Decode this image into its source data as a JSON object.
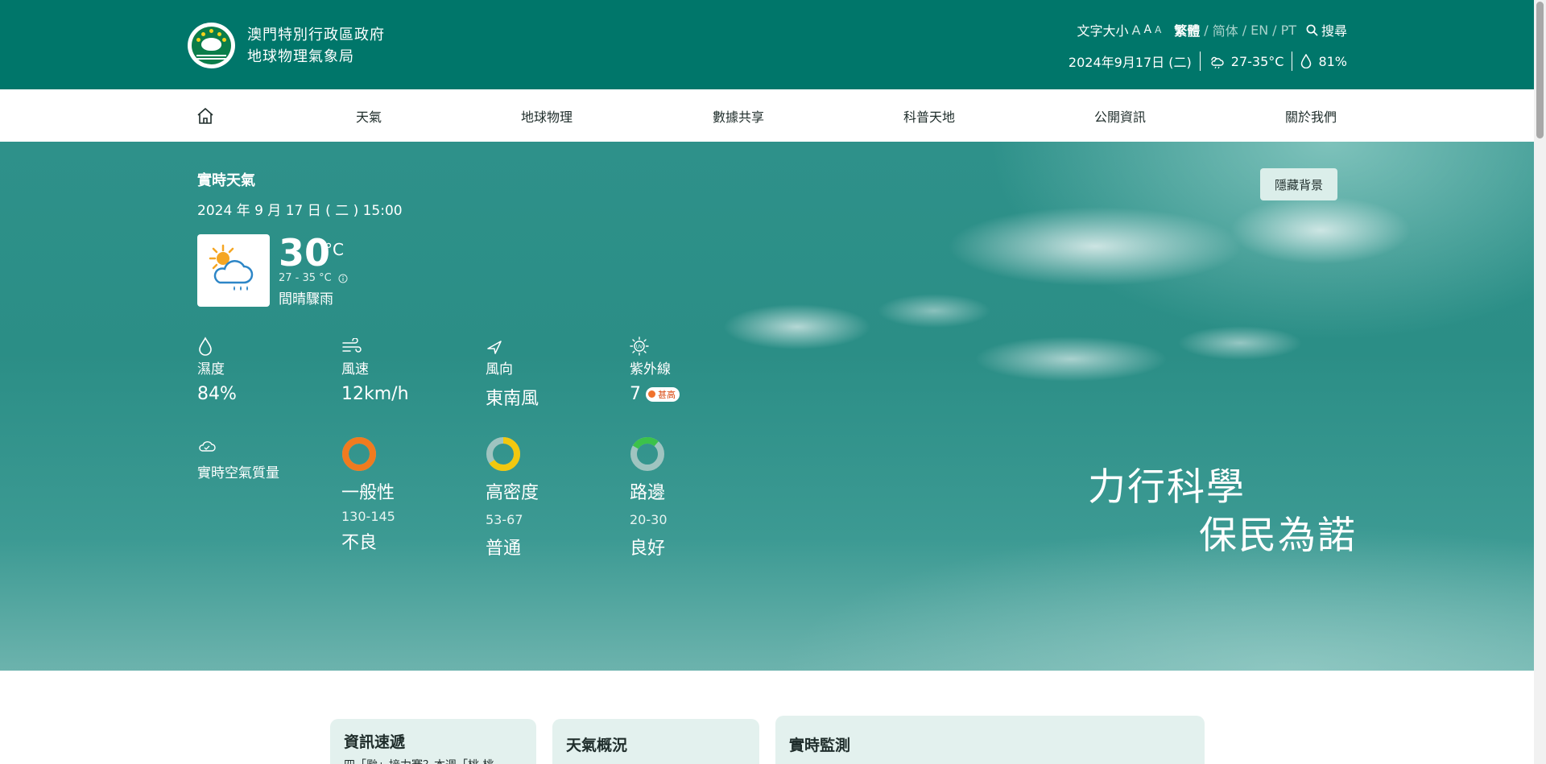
{
  "header": {
    "org_line1": "澳門特別行政區政府",
    "org_line2": "地球物理氣象局",
    "font_size_label": "文字大小",
    "font_a": "A",
    "languages": {
      "trad": "繁體",
      "simp": "简体",
      "en": "EN",
      "pt": "PT",
      "sep": "/"
    },
    "search_label": "搜尋",
    "date": "2024年9月17日 (二)",
    "temp_range": "27-35°C",
    "humidity": "81%"
  },
  "nav": {
    "items": [
      "天氣",
      "地球物理",
      "數據共享",
      "科普天地",
      "公開資訊",
      "關於我們"
    ]
  },
  "hero": {
    "title": "實時天氣",
    "datetime": "2024 年 9 月 17 日 ( 二 ) 15:00",
    "temperature": "30",
    "temp_unit": "°C",
    "temp_range": "27 - 35 °C",
    "condition": "間晴驟雨",
    "hide_bg_label": "隱藏背景",
    "metrics": {
      "humidity": {
        "label": "濕度",
        "value": "84%"
      },
      "wind_speed": {
        "label": "風速",
        "value": "12km/h"
      },
      "wind_dir": {
        "label": "風向",
        "value": "東南風"
      },
      "uv": {
        "label": "紫外線",
        "value": "7",
        "badge": "甚高"
      }
    },
    "air_quality": {
      "label": "實時空氣質量",
      "stations": [
        {
          "title": "一般性",
          "range": "130-145",
          "level": "不良",
          "color": "#f07b1f"
        },
        {
          "title": "高密度",
          "range": "53-67",
          "level": "普通",
          "color": "#f2c80f"
        },
        {
          "title": "路邊",
          "range": "20-30",
          "level": "良好",
          "color": "#3cc24a"
        }
      ]
    },
    "slogan_line1": "力行科學",
    "slogan_line2": "保民為諾"
  },
  "cards": {
    "news": {
      "title": "資訊速遞",
      "snippet": "四「颱」接力賽？本週「桃 桃"
    },
    "overview": {
      "title": "天氣概況"
    },
    "monitor": {
      "title": "實時監測"
    }
  }
}
